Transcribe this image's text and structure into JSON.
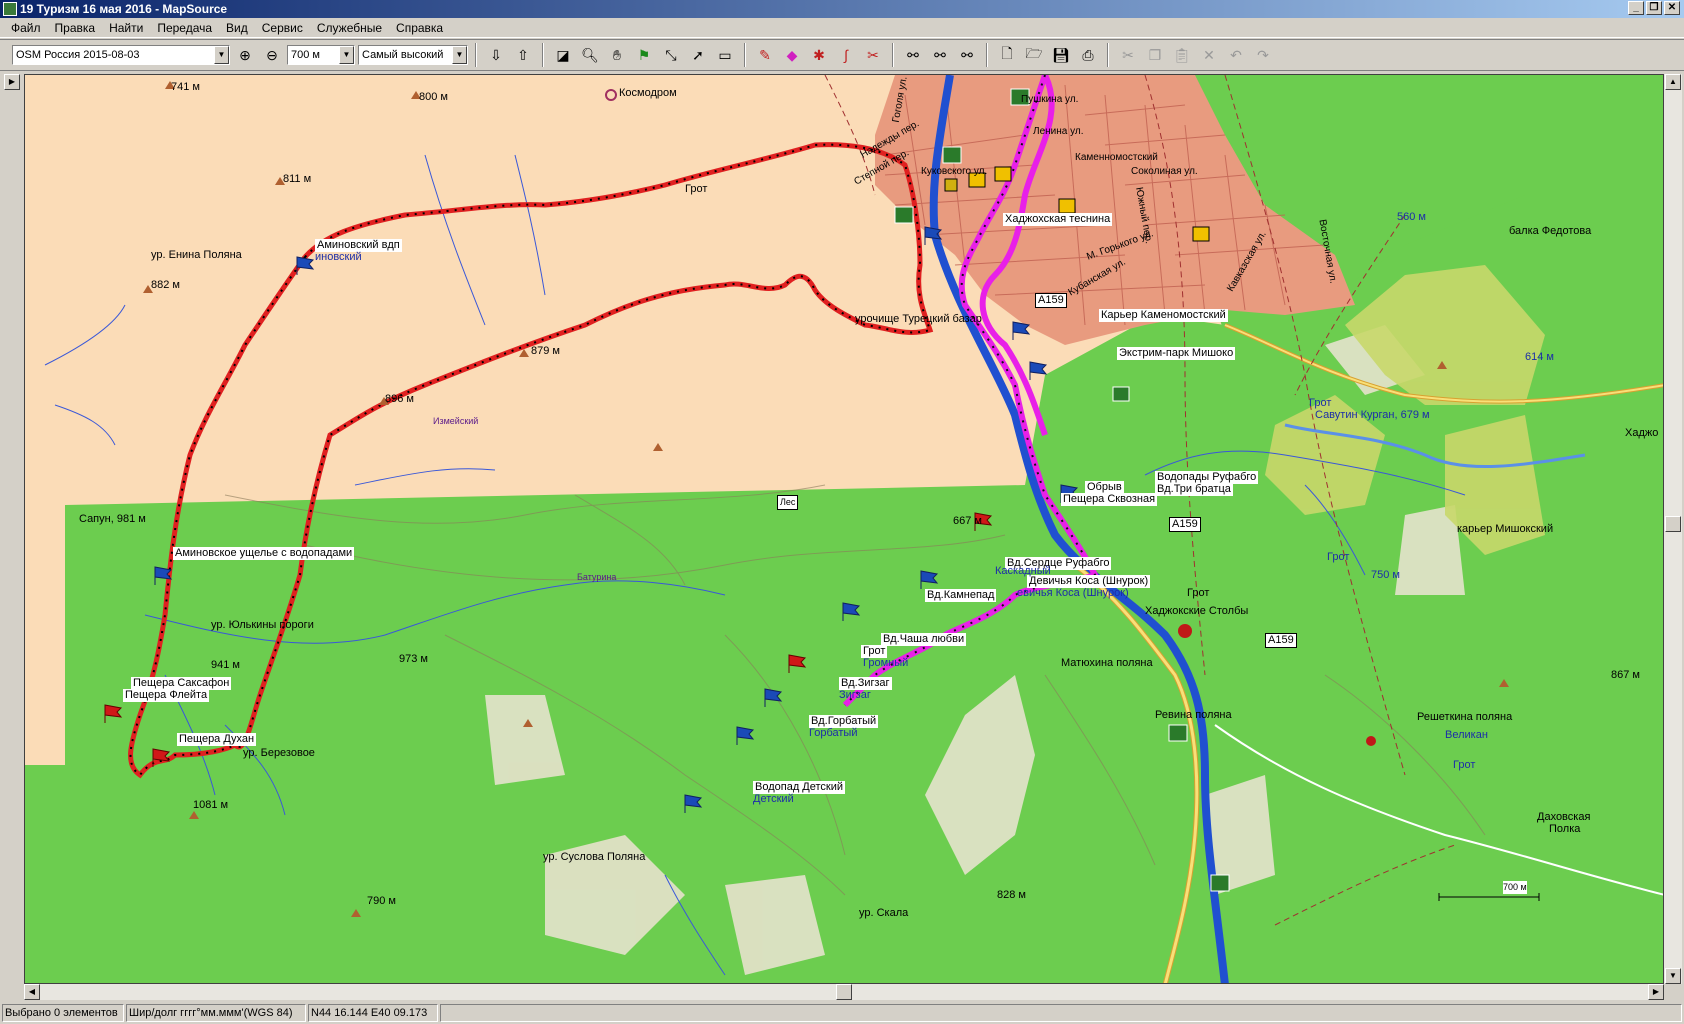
{
  "window": {
    "title": "19 Туризм 16 мая 2016 - MapSource",
    "min": "_",
    "restore": "❐",
    "close": "✕"
  },
  "menu": [
    "Файл",
    "Правка",
    "Найти",
    "Передача",
    "Вид",
    "Сервис",
    "Служебные",
    "Справка"
  ],
  "toolbar": {
    "map_product": "OSM Россия 2015-08-03",
    "zoom_scale": "700 м",
    "detail_level": "Самый высокий",
    "icons": {
      "zoom_in": "zoom-in-icon",
      "zoom_out": "zoom-out-icon",
      "receive": "receive-from-device-icon",
      "send": "send-to-device-icon",
      "map_tool": "map-tool-icon",
      "zoom_tool": "zoom-tool-icon",
      "hand_tool": "hand-tool-icon",
      "waypoint_tool": "waypoint-tool-icon",
      "route_tool": "route-tool-icon",
      "select_tool": "select-tool-icon",
      "measure_tool": "measure-tool-icon",
      "new": "new-file-icon",
      "open": "open-file-icon",
      "save": "save-icon",
      "print": "print-icon",
      "cut": "cut-icon",
      "copy": "copy-icon",
      "paste": "paste-icon",
      "delete": "delete-icon",
      "undo": "undo-icon",
      "redo": "redo-icon"
    }
  },
  "map": {
    "colors": {
      "open_land": "#fbdcb7",
      "forest": "#6ccd4f",
      "urban": "#e89b7f",
      "track": "#e02020",
      "route": "#e820e8",
      "river": "#2050d0"
    },
    "scale_bar": "700 м",
    "labels": {
      "peak_741": "741 м",
      "peak_800": "800 м",
      "kosmodrom": "Космодром",
      "peak_811": "811 м",
      "enina": "ур. Енина Поляна",
      "aminovsky_wp": "Аминовский вдп",
      "aminovsky_sub": "иновский",
      "peak_882": "882 м",
      "grot1": "Грот",
      "urochishche": "урочище Турецкий базар",
      "m879": "879 м",
      "peak_896": "896 м",
      "sapun": "Сапун, 981 м",
      "aminovskoe": "Аминовское ущелье с водопадами",
      "yulkiny": "ур. Юлькины пороги",
      "saksafon": "Пещера Саксафон",
      "fleyta": "Пещера Флейта",
      "peak_941": "941 м",
      "peak_973": "973 м",
      "dukhan": "Пещера Духан",
      "berezovoe": "ур. Березовое",
      "peak_1081": "1081 м",
      "les": "Лес",
      "peak_667": "667 м",
      "obryv": "Обрыв",
      "skvoznaya": "Пещера Сквозная",
      "rufabgo": "Водопады Руфабго",
      "tri_bratca": "Вд.Три братца",
      "a159_1": "А159",
      "a159_2": "А159",
      "a159_3": "А159",
      "serdce": "Вд.Сердце Руфабго",
      "devichya": "Девичья Коса (Шнурок)",
      "devichya_sub": "евичья Коса (Шнурок)",
      "kaskadny": "Каскадный",
      "kamnepad": "Вд.Камнепад",
      "chasha": "Вд.Чаша любви",
      "grot2": "Грот",
      "gromny": "Громный",
      "zigzag": "Вд.Зигзаг",
      "zigzag_sub": "Зигзаг",
      "gorbaty": "Вд.Горбатый",
      "gorbaty_sub": "Горбатый",
      "detsky": "Водопад Детский",
      "detsky_sub": "Детский",
      "suslova": "ур. Суслова Поляна",
      "peak_790": "790 м",
      "peak_828": "828 м",
      "skala": "ур. Скала",
      "khadzhokh_tesnina": "Хаджохская теснина",
      "karier": "Карьер Каменомостский",
      "ekstrim": "Экстрим-парк Мишоко",
      "grot3": "Грот",
      "grot4": "Грот",
      "grot5": "Грот",
      "grot6": "Грот",
      "savutin": "Савутин Курган, 679 м",
      "khadzh": "Хаджо",
      "karier_mishok": "карьер Мишокский",
      "peak_560": "560 м",
      "fedotova": "балка Федотова",
      "peak_614": "614 м",
      "peak_750": "750 м",
      "stolby": "Хаджокские Столбы",
      "matyukhina": "Матюхина поляна",
      "revina": "Ревина поляна",
      "reshetkina": "Решеткина поляна",
      "velikan": "Великан",
      "peak_867": "867 м",
      "dakhovskaya": "Даховская",
      "polka": "Полка",
      "pushkina": "Пушкина ул.",
      "kamennomost": "Каменномостский",
      "kukovskogo": "Куковского ул.",
      "sokolinaya": "Соколиная ул.",
      "yuzhny": "Южный пер.",
      "gogol": "Гоголя ул.",
      "kavkazskaya": "Кавказская ул.",
      "vostochnaya": "Восточная ул.",
      "kubanskaya": "Кубанская ул.",
      "gorkogo": "М. Горького ул.",
      "stepnoy": "Степной пер.",
      "nadezhda": "Надежды пер.",
      "lenina": "Ленина ул.",
      "izmeysky": "Измейский",
      "baturina": "Батурина"
    }
  },
  "status": {
    "selection": "Выбрано 0 элементов",
    "format": "Шир/долг гггг°мм.ммм'(WGS 84)",
    "coords": "N44 16.144 E40 09.173"
  }
}
